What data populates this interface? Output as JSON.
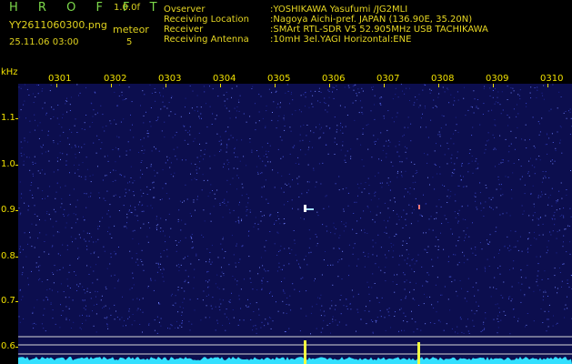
{
  "header": {
    "brand": "H R O F F T",
    "version": "1.0.0f",
    "filename": "YY2611060300.png",
    "meteor_label": "meteor",
    "datetime": "25.11.06 03:00",
    "meteor_count": "5"
  },
  "station": {
    "rows": [
      {
        "key": "Ovserver",
        "value": ":YOSHIKAWA Yasufumi /JG2MLI"
      },
      {
        "key": "Receiving Location",
        "value": ":Nagoya Aichi-pref. JAPAN (136.90E, 35.20N)"
      },
      {
        "key": "Receiver",
        "value": ":SMArt RTL-SDR V5 52.905MHz USB TACHIKAWA"
      },
      {
        "key": "Receiving Antenna",
        "value": ":10mH 3el.YAGI Horizontal:ENE"
      }
    ]
  },
  "axis": {
    "unit": "kHz",
    "y_labels": [
      "1.1",
      "1.0",
      "0.9",
      "0.8",
      "0.7",
      "0.6"
    ],
    "x_labels": [
      "0301",
      "0302",
      "0303",
      "0304",
      "0305",
      "0306",
      "0307",
      "0308",
      "0309",
      "0310"
    ]
  },
  "colors": {
    "background": "#000000",
    "text": "#e6d622",
    "brand": "#7cd94a",
    "waterfall": "#0c0e4e",
    "signal": "#33e0ff"
  }
}
